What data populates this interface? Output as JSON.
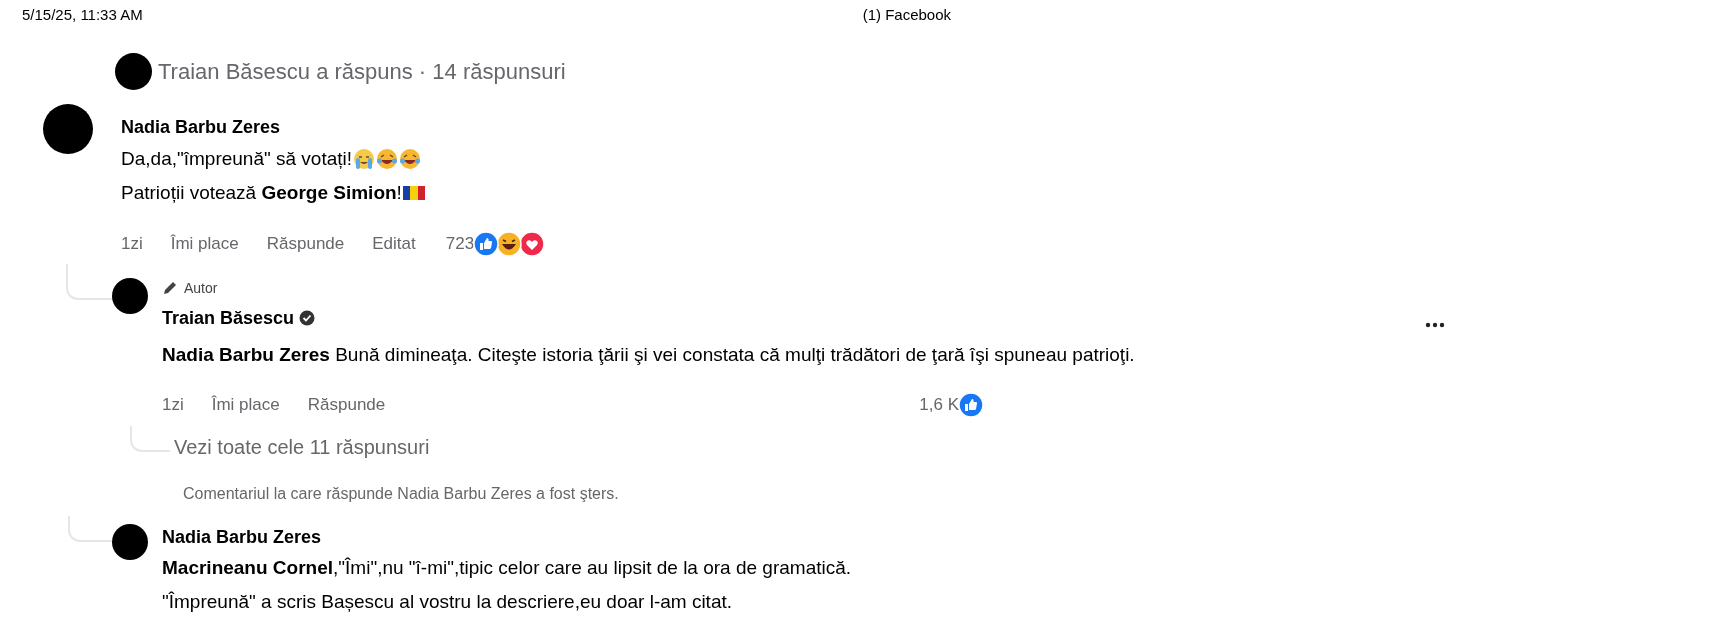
{
  "header": {
    "date": "5/15/25, 11:33 AM",
    "title": "(1) Facebook"
  },
  "thread_summary": "Traian Băsescu a răspuns · 14 răspunsuri",
  "comment": {
    "author": "Nadia Barbu Zeres",
    "lines": [
      {
        "text": "Da,da,\"împreună\" să votați!",
        "emojis": [
          {
            "kind": "tears"
          },
          {
            "kind": "joy"
          },
          {
            "kind": "joy"
          }
        ]
      },
      {
        "text": "Patrioții votează **George Simion**!",
        "emojis": [
          {
            "kind": "flag"
          }
        ]
      }
    ],
    "actions": [
      "1zi",
      "Îmi place",
      "Răspunde",
      "Editat"
    ],
    "reaction_count": "723",
    "reactions": [
      {
        "kind": "like"
      },
      {
        "kind": "haha"
      },
      {
        "kind": "love"
      }
    ]
  },
  "reply": {
    "badge": "Autor",
    "author": "Traian Băsescu",
    "verified": true,
    "text": "**Nadia Barbu Zeres** Bună dimineaţa. Citeşte istoria ţării şi vei constata că mulţi trădători de ţară îşi spuneau patrioţi.",
    "actions": [
      "1zi",
      "Îmi place",
      "Răspunde"
    ],
    "reaction_count": "1,6 K",
    "reactions": [
      {
        "kind": "like"
      }
    ]
  },
  "view_replies": "Vezi toate cele 11 răspunsuri",
  "deleted_notice": "Comentariul la care răspunde Nadia Barbu Zeres a fost şters.",
  "last_comment": {
    "author": "Nadia Barbu Zeres",
    "lines": [
      {
        "text": "**Macrineanu Cornel**,\"Îmi\",nu \"î-mi\",tipic celor care au lipsit de la ora de gramatică."
      },
      {
        "text": "\"Împreună\" a scris Bașescu al vostru la descriere,eu doar l-am citat."
      }
    ]
  }
}
